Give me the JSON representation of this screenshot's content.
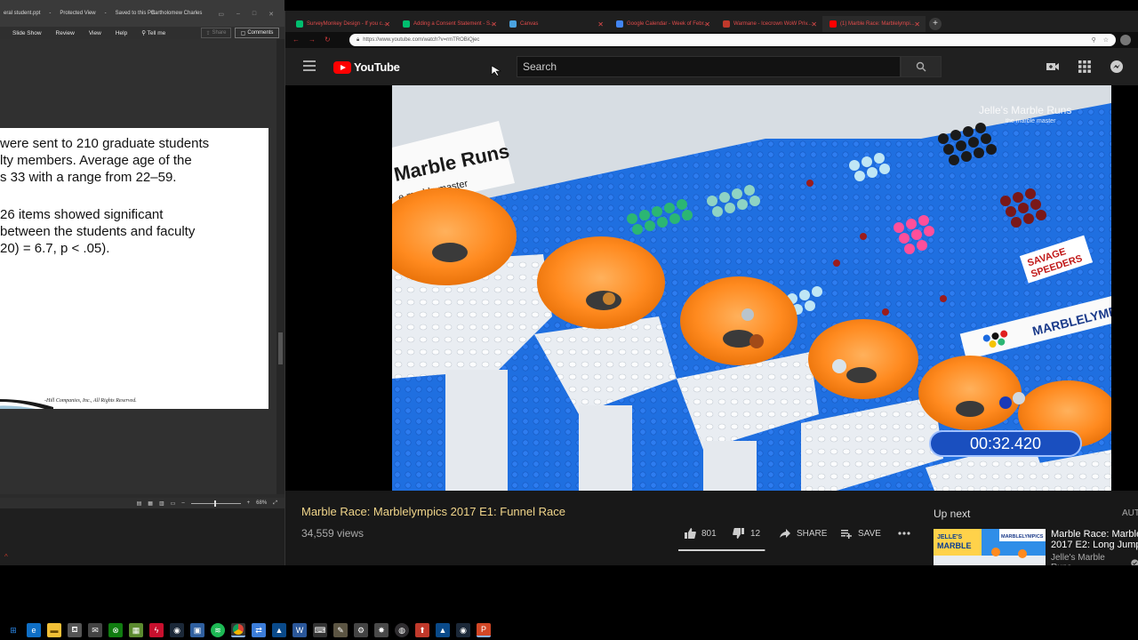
{
  "ppt": {
    "title_file": "eral student.ppt",
    "title_mode": "Protected View",
    "title_saved": "Saved to this PC",
    "user": "Bartholomew Charles",
    "ribbon": [
      "Slide Show",
      "Review",
      "View",
      "Help",
      "Tell me"
    ],
    "share_label": "Share",
    "comments_label": "Comments",
    "slide_lines_1": [
      "were sent to 210 graduate students",
      "lty members. Average age of the",
      "s 33 with a range from 22–59."
    ],
    "slide_lines_2": [
      "26 items showed significant",
      "between the students and faculty",
      "20) = 6.7, p < .05)."
    ],
    "copyright": "-Hill Companies, Inc., All Rights Reserved.",
    "zoom": "68%"
  },
  "browser": {
    "tabs": [
      {
        "label": "SurveyMonkey Design - If you c...",
        "color": "#00bf6f"
      },
      {
        "label": "Adding a Consent Statement - S...",
        "color": "#00bf6f"
      },
      {
        "label": "Canvas",
        "color": "#4aa3df"
      },
      {
        "label": "Google Calendar - Week of Febr...",
        "color": "#4285f4"
      },
      {
        "label": "Warmane - Icecrown WoW Priv...",
        "color": "#c0392b"
      },
      {
        "label": "(1) Marble Race: Marblelympi...",
        "color": "#ff0000"
      }
    ],
    "url": "https://www.youtube.com/watch?v=rmTROBiQjec"
  },
  "youtube": {
    "logo_text": "YouTube",
    "search_placeholder": "Search",
    "timer": "00:32.420",
    "video_title": "Marble Race: Marblelympics 2017 E1: Funnel Race",
    "views": "34,559 views",
    "likes": "801",
    "dislikes": "12",
    "like_fraction": 0.985,
    "share_label": "SHARE",
    "save_label": "SAVE",
    "up_next_label": "Up next",
    "autoplay_label": "AUT",
    "next_title_1": "Marble Race: Marble",
    "next_title_2": "2017 E2: Long Jump",
    "next_channel": "Jelle's Marble Runs",
    "video_sign_1": "Marble Runs",
    "video_sign_2": "e marble master",
    "video_brand": "MARBLELYMP",
    "watermark_1": "Jelle's Marble Runs",
    "watermark_2": "the marble master",
    "savage_1": "SAVAGE",
    "savage_2": "SPEEDERS",
    "thumb_text_1": "JELLE'S",
    "thumb_text_2": "MARBLE",
    "thumb_text_3": "MARBLELYMPICS"
  },
  "colors": {
    "title_accent": "#f0d58a",
    "youtube_red": "#ff0000",
    "timer_blue": "#1a4fbf",
    "funnel_orange": "#ff8a1f"
  },
  "taskbar": {
    "icons": [
      "windows-logo",
      "search",
      "edge",
      "file-explorer",
      "store",
      "mail",
      "xbox",
      "minecraft",
      "vpn",
      "steam",
      "messenger",
      "spotify",
      "chrome",
      "teamviewer",
      "azure",
      "word",
      "terminal",
      "gimp",
      "settings",
      "tool",
      "obs",
      "rocket",
      "azure-2",
      "steam-2",
      "powerpoint"
    ]
  }
}
